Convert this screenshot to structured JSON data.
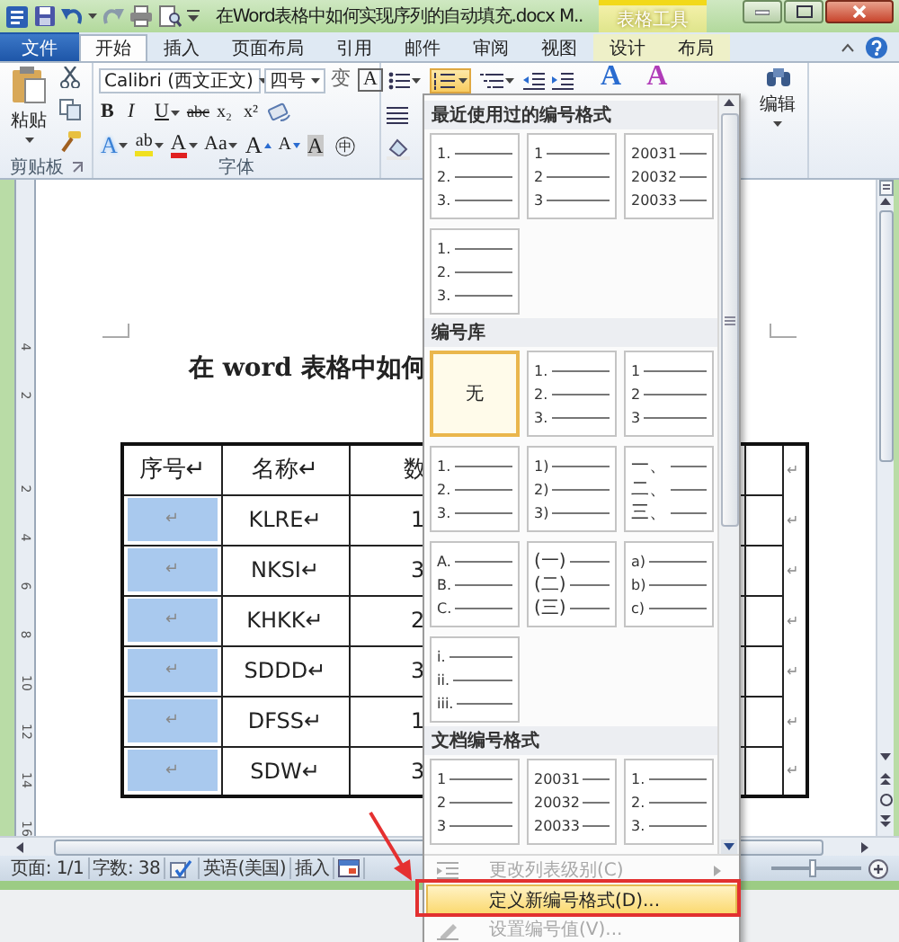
{
  "title_bar": {
    "title": "在Word表格中如何实现序列的自动填充.docx M..",
    "context_group": "表格工具"
  },
  "tabs": [
    {
      "label": "文件",
      "kind": "file",
      "selected": false
    },
    {
      "label": "开始",
      "kind": "normal",
      "selected": true
    },
    {
      "label": "插入",
      "kind": "normal",
      "selected": false
    },
    {
      "label": "页面布局",
      "kind": "normal",
      "selected": false
    },
    {
      "label": "引用",
      "kind": "normal",
      "selected": false
    },
    {
      "label": "邮件",
      "kind": "normal",
      "selected": false
    },
    {
      "label": "审阅",
      "kind": "normal",
      "selected": false
    },
    {
      "label": "视图",
      "kind": "normal",
      "selected": false
    },
    {
      "label": "设计",
      "kind": "context",
      "selected": false
    },
    {
      "label": "布局",
      "kind": "context",
      "selected": false
    }
  ],
  "ribbon": {
    "clipboard": {
      "paste_label": "粘贴",
      "label": "剪贴板"
    },
    "font": {
      "font_name": "Calibri (西文正文)",
      "font_size": "四号",
      "label": "字体",
      "row1": [
        {
          "kind": "phonetic",
          "glyph": "变",
          "menu": false
        },
        {
          "kind": "border",
          "glyph": "A",
          "menu": false
        }
      ],
      "row2": [
        {
          "kind": "bold",
          "glyph": "B",
          "menu": false
        },
        {
          "kind": "italic",
          "glyph": "I",
          "menu": false
        },
        {
          "kind": "underline",
          "glyph": "U",
          "menu": true
        },
        {
          "kind": "strike",
          "glyph": "abc",
          "menu": false
        },
        {
          "kind": "sub",
          "glyph": "x₂",
          "menu": false
        },
        {
          "kind": "super",
          "glyph": "x²",
          "menu": false
        }
      ],
      "row3": [
        {
          "kind": "effects",
          "glyph": "A",
          "menu": true
        },
        {
          "kind": "highlight",
          "glyph": "ab",
          "menu": true
        },
        {
          "kind": "color",
          "glyph": "A",
          "menu": true
        },
        {
          "kind": "case",
          "glyph": "Aa",
          "menu": true
        },
        {
          "kind": "grow",
          "glyph": "A",
          "menu": false
        },
        {
          "kind": "shrink",
          "glyph": "A",
          "menu": false
        },
        {
          "kind": "shade",
          "glyph": "A",
          "menu": false
        },
        {
          "kind": "enclose",
          "glyph": "㊥",
          "menu": false
        }
      ]
    },
    "styles": [
      {
        "glyph": "A",
        "color": "#2a6cd0"
      },
      {
        "glyph": "A",
        "color": "#b03cb8"
      }
    ],
    "editing": {
      "label": "编辑"
    }
  },
  "document": {
    "ruler_top_labels": [
      "4",
      "2"
    ],
    "ruler_labels": [
      "2",
      "4",
      "6",
      "8",
      "10",
      "12",
      "14",
      "16"
    ],
    "heading": "在 word 表格中如何",
    "table": {
      "header": {
        "number": "序号↵",
        "name": "名称↵",
        "column_3": "数",
        "row_end": "↵"
      },
      "rows": [
        {
          "number": {
            "text": "↵",
            "selected": true
          },
          "name": "KLRE↵",
          "column_3": "1",
          "row_end": "↵"
        },
        {
          "number": {
            "text": "↵",
            "selected": true
          },
          "name": "NKSI↵",
          "column_3": "3",
          "row_end": "↵"
        },
        {
          "number": {
            "text": "↵",
            "selected": true
          },
          "name": "KHKK↵",
          "column_3": "2",
          "row_end": "↵"
        },
        {
          "number": {
            "text": "↵",
            "selected": true
          },
          "name": "SDDD↵",
          "column_3": "3",
          "row_end": "↵"
        },
        {
          "number": {
            "text": "↵",
            "selected": true
          },
          "name": "DFSS↵",
          "column_3": "1",
          "row_end": "↵"
        },
        {
          "number": {
            "text": "↵",
            "selected": true
          },
          "name": "SDW↵",
          "column_3": "3",
          "row_end": "↵"
        }
      ]
    }
  },
  "status_bar": {
    "page": "页面: 1/1",
    "words": "字数: 38",
    "language": "英语(美国)",
    "mode": "插入",
    "zoom_slider": {
      "level": 0.45
    }
  },
  "numbering_menu": {
    "sections": [
      {
        "title": "最近使用过的编号格式",
        "items": [
          {
            "kind": "list",
            "lines": [
              "1.",
              "2.",
              "3."
            ],
            "selected": false
          },
          {
            "kind": "list",
            "lines": [
              "1",
              "2",
              "3"
            ],
            "selected": false
          },
          {
            "kind": "list",
            "lines": [
              "20031",
              "20032",
              "20033"
            ],
            "selected": false
          },
          {
            "kind": "list",
            "lines": [
              "1.",
              "2.",
              "3."
            ],
            "selected": false
          }
        ]
      },
      {
        "title": "编号库",
        "items": [
          {
            "kind": "none",
            "label": "无",
            "selected": true
          },
          {
            "kind": "list",
            "lines": [
              "1.",
              "2.",
              "3."
            ],
            "selected": false
          },
          {
            "kind": "list",
            "lines": [
              "1",
              "2",
              "3"
            ],
            "selected": false
          },
          {
            "kind": "list",
            "lines": [
              "1.",
              "2.",
              "3."
            ],
            "selected": false
          },
          {
            "kind": "list",
            "lines": [
              "1)",
              "2)",
              "3)"
            ],
            "selected": false
          },
          {
            "kind": "list",
            "lines": [
              "一、",
              "二、",
              "三、"
            ],
            "selected": false
          },
          {
            "kind": "list",
            "lines": [
              "A.",
              "B.",
              "C."
            ],
            "selected": false
          },
          {
            "kind": "list",
            "lines": [
              "(一)",
              "(二)",
              "(三)"
            ],
            "selected": false
          },
          {
            "kind": "list",
            "lines": [
              "a)",
              "b)",
              "c)"
            ],
            "selected": false
          },
          {
            "kind": "list",
            "lines": [
              "i.",
              "ii.",
              "iii."
            ],
            "selected": false
          }
        ]
      },
      {
        "title": "文档编号格式",
        "items": [
          {
            "kind": "list",
            "lines": [
              "1",
              "2",
              "3"
            ],
            "selected": false
          },
          {
            "kind": "list",
            "lines": [
              "20031",
              "20032",
              "20033"
            ],
            "selected": false
          },
          {
            "kind": "list",
            "lines": [
              "1.",
              "2.",
              "3."
            ],
            "selected": false
          }
        ]
      }
    ],
    "commands": [
      {
        "label": "更改列表级别(C)",
        "kind": "indent",
        "disabled": true,
        "submenu": true,
        "highlighted": false
      },
      {
        "label": "定义新编号格式(D)...",
        "kind": "plain",
        "disabled": false,
        "submenu": false,
        "highlighted": true
      },
      {
        "label": "设置编号值(V)...",
        "kind": "value",
        "disabled": true,
        "submenu": false,
        "highlighted": false
      }
    ]
  },
  "annotations": {
    "arrow": true,
    "frame": true
  }
}
